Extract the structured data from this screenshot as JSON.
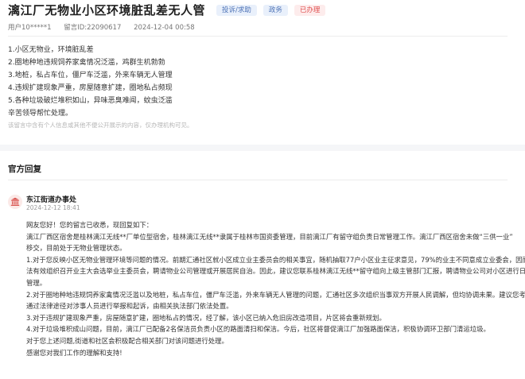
{
  "header": {
    "title": "漓江厂无物业小区环境脏乱差无人管",
    "tags": [
      "投诉/求助",
      "政务",
      "已办理"
    ]
  },
  "meta": {
    "user": "用户10*****1",
    "message_id": "留言ID:22090617",
    "timestamp": "2024-12-04 00:58"
  },
  "message": {
    "lines": [
      "1.小区无物业，环境脏乱差",
      "2.圈地种地违规饲养家禽情况泛滥，鸡群生机勃勃",
      "3.地桩，私占车位，僵尸车泛滥，外来车辆无人管理",
      "4.违规扩建现象严重，房屋随意扩建，圈地私占频现",
      "5.各种垃圾破烂堆积如山，异味恶臭难闻，蚊虫泛滥",
      "辛苦领导帮忙处理。"
    ],
    "disclaimer": "该留言中含有个人信息或其他不便公开展示的内容，仅办理机构可见。"
  },
  "reply": {
    "section_title": "官方回复",
    "org_name": "东江街道办事处",
    "time": "2024-12-12 18:41",
    "avatar_icon": "government-building-icon",
    "lines": [
      "网友您好！您的留言已收悉，现回复如下：",
      "漓江厂西区宿舍是桂林漓江无线**厂单位型宿舍，桂林漓江无线**隶属于桂林市国资委管理，目前漓江厂有留守组负责日常管理工作。漓江厂西区宿舍未做“三供一业”",
      "移交，目前处于无物业管理状态。",
      "1.对于您反映小区无物业管理环境等问题的情况。前期汇通社区就小区成立业主委员会的相关事宜，随机抽取77户小区业主征求意见，79%的业主不同意成立业委会，因而无",
      "法有效组织召开业主大会选举业主委员会，聘请物业公司管理或开展居民自治。因此，建议您联系桂林漓江无线**留守组向上级主管部门汇报，聘请物业公司对小区进行日常",
      "管理。",
      "2.对于圈地种地违规饲养家禽情况泛滥以及地桩，私占车位，僵尸车泛滥，外来车辆无人管理的问题，汇通社区多次组织当事双方开展人民调解，但均协调未果。建议您考虑",
      "通过法律途径对涉事人员进行举报和起诉，由相关执法部门依法处置。",
      "3.对于违规扩建现象严重，房屋随意扩建，圈地私占的情况，经了解，该小区已纳入危旧房改造项目，片区将会重新规划。",
      "4.对于垃圾堆积成山问题，目前，漓江厂已配备2名保洁员负责小区的路面清扫和保洁。今后，社区将督促漓江厂加强路面保洁，积极协调环卫部门清运垃圾。",
      "对于您上述问题,街道和社区会积极配合相关部门对该问题进行处理。",
      "感谢您对我们工作的理解和支持!"
    ]
  },
  "colors": {
    "tag_blue_bg": "#e9f0fb",
    "tag_blue_text": "#4f74b7",
    "tag_red_bg": "#fdecec",
    "tag_red_text": "#e05151",
    "avatar_accent": "#d9534f"
  }
}
